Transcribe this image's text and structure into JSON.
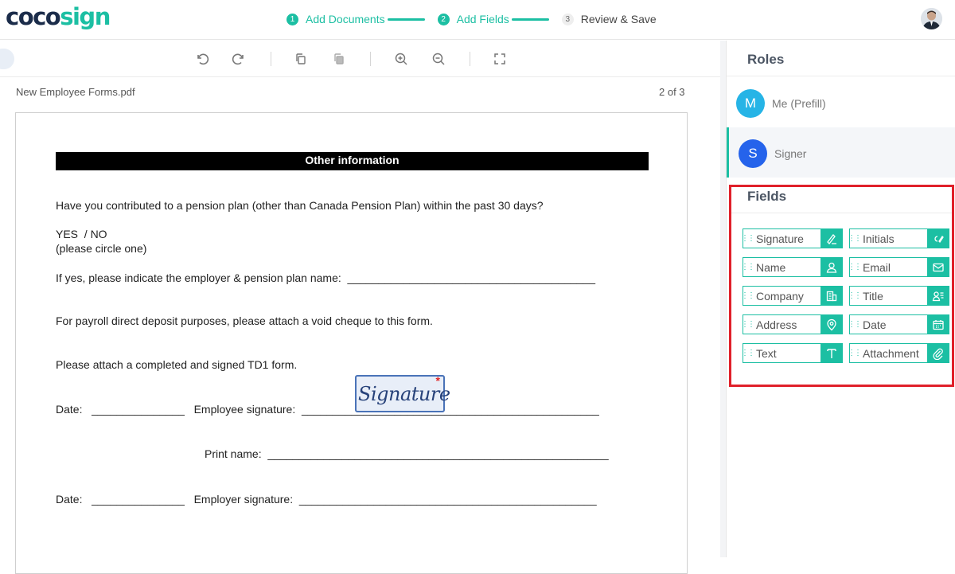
{
  "app": {
    "logo_part1": "coco",
    "logo_part2": "sign"
  },
  "steps": [
    {
      "num": "1",
      "label": "Add Documents",
      "state": "done"
    },
    {
      "num": "2",
      "label": "Add Fields",
      "state": "done"
    },
    {
      "num": "3",
      "label": "Review & Save",
      "state": "todo"
    }
  ],
  "document": {
    "filename": "New Employee Forms.pdf",
    "page_indicator": "2 of 3",
    "section_title": "Other information",
    "lines": {
      "q1": "Have you contributed to a pension plan (other than Canada Pension Plan) within the past 30 days?",
      "yesno": "YES  / NO",
      "circle": "(please circle one)",
      "employer": "If yes, please indicate the employer & pension plan name:  ________________________________________",
      "payroll": "For payroll direct deposit purposes, please attach a void cheque to this form.",
      "td1": "Please attach a completed and signed TD1 form.",
      "date1": "Date:   _______________   Employee signature:  ________________________________________________",
      "print": "Print name:  _______________________________________________________",
      "date2": "Date:   _______________   Employer signature:  ________________________________________________"
    },
    "signature_field": {
      "label": "Signature",
      "required_mark": "*"
    }
  },
  "roles_panel": {
    "title": "Roles",
    "roles": [
      {
        "initial": "M",
        "name": "Me (Prefill)",
        "color": "#26b4e6",
        "active": false
      },
      {
        "initial": "S",
        "name": "Signer",
        "color": "#2563eb",
        "active": true
      }
    ]
  },
  "fields_panel": {
    "title": "Fields",
    "fields": [
      {
        "label": "Signature",
        "icon": "signature-pen-icon"
      },
      {
        "label": "Initials",
        "icon": "initials-pen-icon"
      },
      {
        "label": "Name",
        "icon": "person-icon"
      },
      {
        "label": "Email",
        "icon": "envelope-icon"
      },
      {
        "label": "Company",
        "icon": "building-icon"
      },
      {
        "label": "Title",
        "icon": "person-lines-icon"
      },
      {
        "label": "Address",
        "icon": "location-pin-icon"
      },
      {
        "label": "Date",
        "icon": "calendar-icon"
      },
      {
        "label": "Text",
        "icon": "text-t-icon"
      },
      {
        "label": "Attachment",
        "icon": "paperclip-icon"
      }
    ]
  },
  "colors": {
    "accent": "#1cbfa3",
    "highlight_frame": "#e0202a",
    "brand_dark": "#1b2c4a"
  }
}
